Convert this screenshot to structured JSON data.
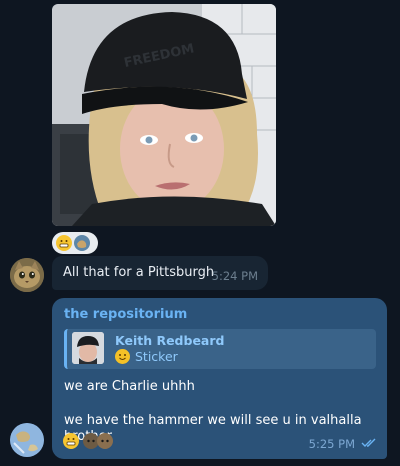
{
  "photo_message": {
    "image_name": "woman-in-black-cap-photo",
    "cap_text": "FREEDOM"
  },
  "photo_reactions": [
    "grinning-emoji",
    "earth-sticker-emoji"
  ],
  "incoming_message": {
    "text": "All that for a Pittsburgh",
    "time": "5:24 PM"
  },
  "outgoing_message": {
    "sender": "the repositorium",
    "reply": {
      "name": "Keith Redbeard",
      "type": "Sticker"
    },
    "lines": [
      "we are Charlie uhhh",
      "we have the hammer we will see u in valhalla brother"
    ],
    "time": "5:25 PM",
    "read_icon": "double-check-icon",
    "reactions": [
      "grinning-emoji",
      "cat-emoji",
      "cat-emoji"
    ]
  },
  "colors": {
    "background": "#0e1621",
    "incoming_bubble": "#182533",
    "outgoing_bubble": "#2b5278",
    "accent": "#6ab3f3"
  }
}
